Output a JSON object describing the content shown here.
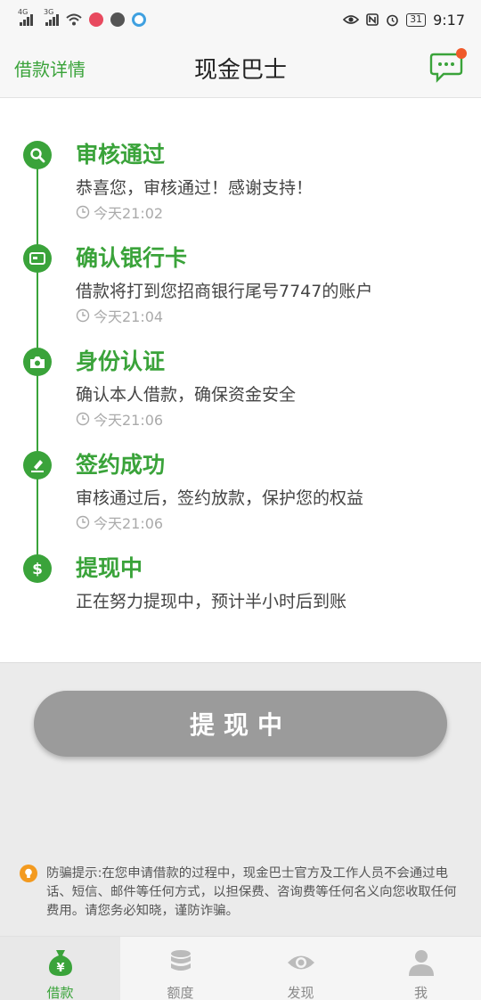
{
  "status_bar": {
    "net1": "4G",
    "net2": "3G",
    "battery": "31",
    "time": "9:17"
  },
  "header": {
    "back_label": "借款详情",
    "title": "现金巴士"
  },
  "steps": [
    {
      "title": "审核通过",
      "desc": "恭喜您，审核通过！感谢支持！",
      "time": "今天21:02",
      "icon": "search-icon"
    },
    {
      "title": "确认银行卡",
      "desc": "借款将打到您招商银行尾号7747的账户",
      "time": "今天21:04",
      "icon": "bank-card-icon"
    },
    {
      "title": "身份认证",
      "desc": "确认本人借款，确保资金安全",
      "time": "今天21:06",
      "icon": "camera-icon"
    },
    {
      "title": "签约成功",
      "desc": "审核通过后，签约放款，保护您的权益",
      "time": "今天21:06",
      "icon": "sign-icon"
    },
    {
      "title": "提现中",
      "desc": "正在努力提现中，预计半小时后到账",
      "icon": "dollar-icon"
    }
  ],
  "action_button": "提现中",
  "notice": "防骗提示:在您申请借款的过程中，现金巴士官方及工作人员不会通过电话、短信、邮件等任何方式，以担保费、咨询费等任何名义向您收取任何费用。请您务必知晓，谨防诈骗。",
  "tabs": [
    {
      "label": "借款",
      "icon": "money-bag-icon",
      "active": true
    },
    {
      "label": "额度",
      "icon": "coins-icon",
      "active": false
    },
    {
      "label": "发现",
      "icon": "eye-icon",
      "active": false
    },
    {
      "label": "我",
      "icon": "person-icon",
      "active": false
    }
  ],
  "colors": {
    "primary": "#3aa33a",
    "badge": "#f05a2a",
    "button": "#9b9b9b",
    "notice_icon": "#f39a1f"
  }
}
